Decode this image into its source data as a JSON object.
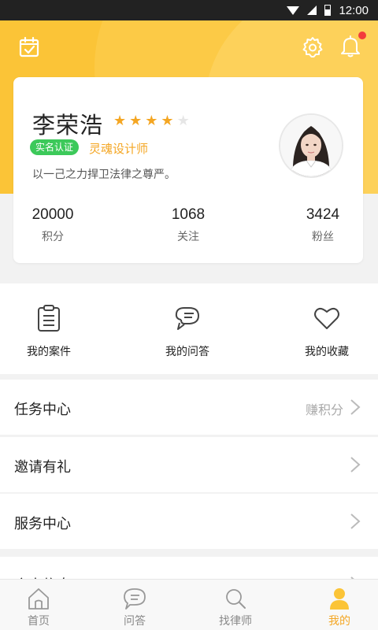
{
  "status_bar": {
    "time": "12:00"
  },
  "colors": {
    "accent": "#fbc437",
    "highlight": "#f4a623",
    "verified": "#3cc95a",
    "notification": "#f33c3c"
  },
  "header": {
    "icons": [
      "calendar-check-icon",
      "gear-icon",
      "bell-icon"
    ],
    "has_notification": true
  },
  "profile": {
    "name": "李荣浩",
    "rating": 4,
    "rating_max": 5,
    "verify_badge": "实名认证",
    "title": "灵魂设计师",
    "signature": "以一己之力捍卫法律之尊严。",
    "stats": [
      {
        "value": "20000",
        "label": "积分"
      },
      {
        "value": "1068",
        "label": "关注"
      },
      {
        "value": "3424",
        "label": "粉丝"
      }
    ]
  },
  "quick_actions": [
    {
      "label": "我的案件",
      "icon": "clipboard-icon"
    },
    {
      "label": "我的问答",
      "icon": "chat-bubbles-icon"
    },
    {
      "label": "我的收藏",
      "icon": "heart-icon"
    }
  ],
  "menu": [
    {
      "label": "任务中心",
      "extra": "赚积分"
    },
    {
      "label": "邀请有礼",
      "extra": ""
    },
    {
      "label": "服务中心",
      "extra": ""
    },
    {
      "label": "个人信息",
      "extra": ""
    }
  ],
  "tab_bar": [
    {
      "label": "首页",
      "icon": "home-icon",
      "active": false
    },
    {
      "label": "问答",
      "icon": "chat-icon",
      "active": false
    },
    {
      "label": "找律师",
      "icon": "search-icon",
      "active": false
    },
    {
      "label": "我的",
      "icon": "person-icon",
      "active": true
    }
  ]
}
